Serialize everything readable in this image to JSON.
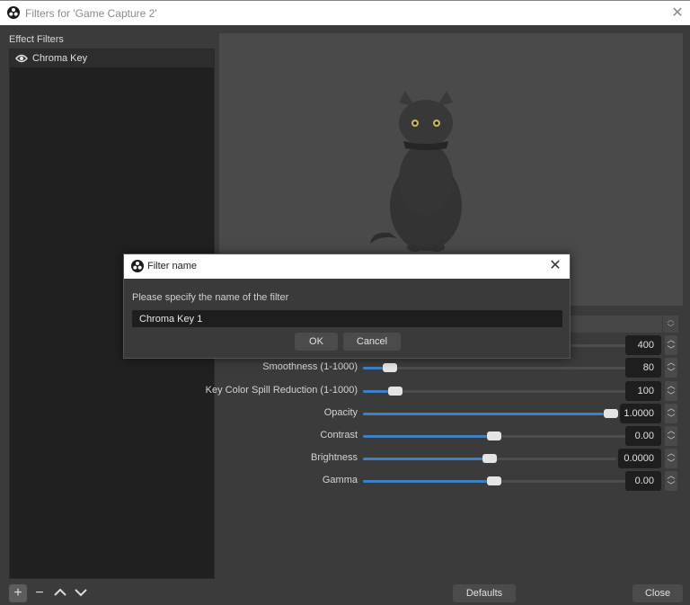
{
  "window": {
    "title": "Filters for 'Game Capture 2'",
    "close_icon": "close-icon"
  },
  "left_panel": {
    "heading": "Effect Filters",
    "filters": [
      {
        "label": "Chroma Key",
        "visible": true,
        "icon": "eye-icon"
      }
    ],
    "toolbar": {
      "add": "+",
      "remove": "−",
      "move_up": "︿",
      "move_down": "﹀"
    }
  },
  "preview": {
    "content": "black cat sitting"
  },
  "properties": [
    {
      "label": "",
      "value": "400",
      "fill": 0.4
    },
    {
      "label": "Smoothness (1-1000)",
      "value": "80",
      "fill": 0.08
    },
    {
      "label": "Key Color Spill Reduction (1-1000)",
      "value": "100",
      "fill": 0.1
    },
    {
      "label": "Opacity",
      "value": "1.0000",
      "fill": 1.0
    },
    {
      "label": "Contrast",
      "value": "0.00",
      "fill": 0.5
    },
    {
      "label": "Brightness",
      "value": "0.0000",
      "fill": 0.5
    },
    {
      "label": "Gamma",
      "value": "0.00",
      "fill": 0.5
    }
  ],
  "footer": {
    "defaults_label": "Defaults",
    "close_label": "Close"
  },
  "modal": {
    "title": "Filter name",
    "prompt": "Please specify the name of the filter",
    "input_value": "Chroma Key 1",
    "ok_label": "OK",
    "cancel_label": "Cancel"
  },
  "colors": {
    "accent": "#3d80c6",
    "background": "#3b3b3b",
    "list_background": "#202020"
  }
}
